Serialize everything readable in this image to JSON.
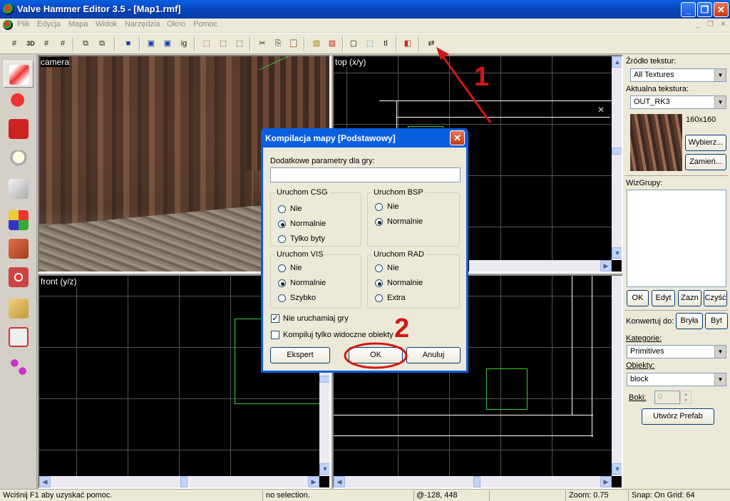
{
  "window": {
    "title": "Valve Hammer Editor 3.5 - [Map1.rmf]"
  },
  "menu": [
    "Plik",
    "Edycja",
    "Mapa",
    "Widok",
    "Narzędzia",
    "Okno",
    "Pomoc"
  ],
  "toolbar": {
    "b2": "3D",
    "b_ig": "ig",
    "b_tl": "tl"
  },
  "viewports": {
    "camera": "camera",
    "top": "top (x/y)",
    "front": "front (y/z)"
  },
  "right_panel": {
    "texture_source_label": "Źródło tekstur:",
    "texture_source_value": "All Textures",
    "current_texture_label": "Aktualna tekstura:",
    "current_texture_value": "OUT_RK3",
    "texture_size": "160x160",
    "choose_button": "Wybierz...",
    "replace_button": "Zamień...",
    "visgroups_label": "WizGrupy:",
    "ok_button": "OK",
    "edit_button": "Edyt",
    "mark_button": "Zazn",
    "purge_button": "Czyść",
    "convert_label": "Konwertuj do:",
    "solid_button": "Bryła",
    "entity_button": "Byt",
    "categories_label": "Kategorie:",
    "categories_value": "Primitives",
    "objects_label": "Objekty:",
    "objects_value": "block",
    "faces_label": "Boki:",
    "faces_value": "0",
    "create_prefab_button": "Utwórz Prefab"
  },
  "dialog": {
    "title": "Kompilacja mapy [Podstawowy]",
    "params_label": "Dodatkowe parametry dla gry:",
    "params_value": "",
    "csg": {
      "title": "Uruchom CSG",
      "options": [
        "Nie",
        "Normalnie",
        "Tylko byty"
      ],
      "selected": "Normalnie"
    },
    "bsp": {
      "title": "Uruchom BSP",
      "options": [
        "Nie",
        "Normalnie"
      ],
      "selected": "Normalnie"
    },
    "vis": {
      "title": "Uruchom VIS",
      "options": [
        "Nie",
        "Normalnie",
        "Szybko"
      ],
      "selected": "Normalnie"
    },
    "rad": {
      "title": "Uruchom RAD",
      "options": [
        "Nie",
        "Normalnie",
        "Extra"
      ],
      "selected": "Normalnie"
    },
    "dont_run_game": {
      "label": "Nie uruchamiaj gry",
      "checked": true
    },
    "visible_only": {
      "label": "Kompiluj tylko widoczne obiekty",
      "checked": false
    },
    "expert_button": "Ekspert",
    "ok_button": "OK",
    "cancel_button": "Anuluj"
  },
  "annotations": {
    "marker1": "1",
    "marker2": "2"
  },
  "status": {
    "help": "Wciśnij F1 aby uzyskać pomoc.",
    "selection": "no selection.",
    "coords": "@-128, 448",
    "zoom": "Zoom: 0.75",
    "snap": "Snap: On Grid: 64"
  },
  "colors": {
    "annotation_red": "#d31616",
    "grid_line": "#555555",
    "brush_green": "#3ec93e"
  }
}
